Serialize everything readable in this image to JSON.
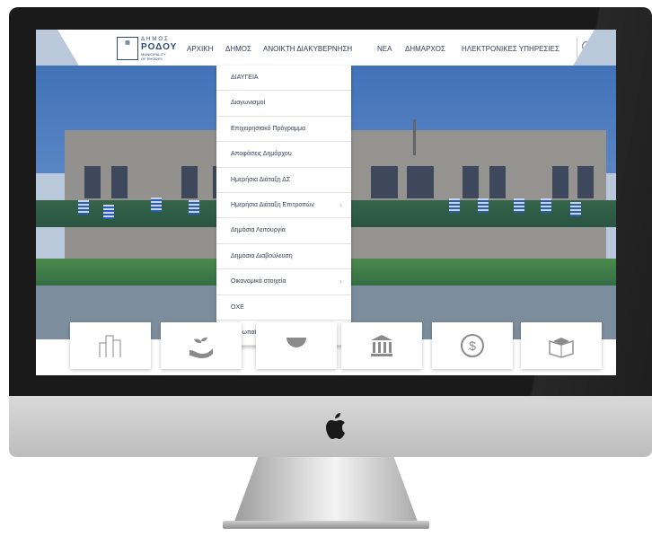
{
  "header": {
    "logo": {
      "line1": "ΔΗΜΟΣ",
      "line2": "ΡΟΔΟΥ",
      "line3a": "MUNICIPALITY",
      "line3b": "OF RHODES"
    },
    "nav": [
      "ΑΡΧΙΚΗ",
      "ΔΗΜΟΣ",
      "ΑΝΟΙΚΤΗ ΔΙΑΚΥΒΕΡΝΗΣΗ",
      "ΝΕΑ",
      "ΔΗΜΑΡΧΟΣ",
      "ΗΛΕΚΤΡΟΝΙΚΕΣ ΥΠΗΡΕΣΙΕΣ"
    ],
    "search_icon": "search-icon"
  },
  "dropdown": {
    "items": [
      {
        "label": "ΔΙΑΥΓΕΙΑ",
        "submenu": false
      },
      {
        "label": "Διαγωνισμοί",
        "submenu": false
      },
      {
        "label": "Επιχειρησιακό Πρόγραμμα",
        "submenu": false
      },
      {
        "label": "Αποφάσεις Δημάρχου",
        "submenu": false
      },
      {
        "label": "Ημερήσια Διάταξη ΔΣ",
        "submenu": false
      },
      {
        "label": "Ημερήσια Διάταξη Επιτροπών",
        "submenu": true
      },
      {
        "label": "Δημόσια Λειτουργία",
        "submenu": false
      },
      {
        "label": "Δημόσια Διαβούλευση",
        "submenu": false
      },
      {
        "label": "Οικονομικά στοιχεία",
        "submenu": true
      },
      {
        "label": "ΟΧΕ",
        "submenu": false
      },
      {
        "label": "Ευρωπαϊκά Προγράμματα",
        "submenu": false
      }
    ],
    "arrow": "›"
  },
  "tiles": [
    "buildings-icon",
    "plant-in-hand-icon",
    "globe-icon",
    "columns-icon",
    "dollar-globe-icon",
    "graduation-book-icon"
  ],
  "colors": {
    "nav_text": "#2f3c55",
    "brand": "#2b4b7a",
    "tile_icon": "#8a8a8a"
  }
}
